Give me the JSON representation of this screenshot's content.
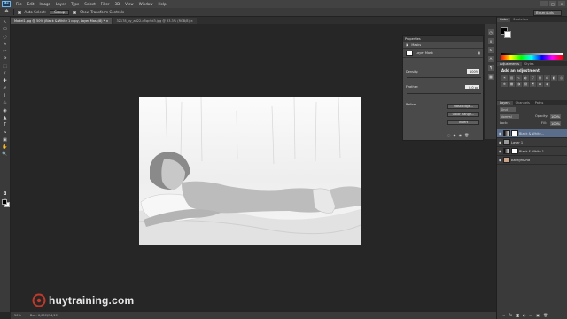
{
  "app": {
    "logo": "Ps"
  },
  "menu": [
    "File",
    "Edit",
    "Image",
    "Layer",
    "Type",
    "Select",
    "Filter",
    "3D",
    "View",
    "Window",
    "Help"
  ],
  "window_controls": [
    "–",
    "□",
    "×"
  ],
  "options_bar": {
    "auto_select_label": "Auto-Select:",
    "auto_select_value": "Group",
    "transform_label": "Show Transform Controls",
    "workspace": "Essentials"
  },
  "tabs": [
    {
      "label": "Model1.jpg @ 50% (Black & White 1 copy, Layer Mask/8) *",
      "active": true
    },
    {
      "label": "32178_by_ad22-d5qc9d3.jpg @ 33.3% (RGB/8)",
      "active": false
    }
  ],
  "tools": [
    "↖",
    "▭",
    "◌",
    "✎",
    "✂",
    "⊘",
    "⬚",
    "∕",
    "✚",
    "✐",
    "⌇",
    "♨",
    "◉",
    "▲",
    "T",
    "↘",
    "▣",
    "✋",
    "🔍"
  ],
  "status": {
    "zoom": "50%",
    "doc": "Doc: 6,00M/14,2M"
  },
  "watermark": "huytraining.com",
  "properties": {
    "title": "Properties",
    "section": "Masks",
    "mask_label": "Layer Mask",
    "density_label": "Density:",
    "density_value": "100%",
    "feather_label": "Feather:",
    "feather_value": "0.0 px",
    "refine_label": "Refine:",
    "btn_mask_edge": "Mask Edge...",
    "btn_color_range": "Color Range...",
    "btn_invert": "Invert"
  },
  "panels": {
    "color_tabs": [
      "Color",
      "Swatches"
    ],
    "adjust_tabs": [
      "Adjustments",
      "Styles"
    ],
    "add_adjustment": "Add an adjustment",
    "layers_tabs": [
      "Layers",
      "Channels",
      "Paths"
    ],
    "kind_label": "Kind",
    "blend_mode": "Normal",
    "opacity_label": "Opacity:",
    "opacity_value": "100%",
    "lock_label": "Lock:",
    "fill_label": "Fill:",
    "fill_value": "100%",
    "layers": [
      {
        "name": "Black & White...",
        "selected": true
      },
      {
        "name": "Layer 1",
        "selected": false
      },
      {
        "name": "Black & White 1",
        "selected": false
      },
      {
        "name": "Background",
        "selected": false
      }
    ]
  }
}
